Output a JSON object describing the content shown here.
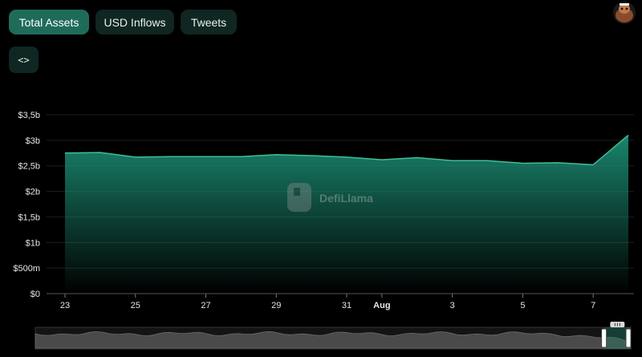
{
  "tabs": [
    {
      "label": "Total Assets",
      "active": true
    },
    {
      "label": "USD Inflows",
      "active": false
    },
    {
      "label": "Tweets",
      "active": false
    }
  ],
  "embed_button": {
    "label": "<>"
  },
  "watermark": {
    "text": "DefiLlama"
  },
  "colors": {
    "accent": "#1f6b5a",
    "tab_bg": "#0f2622",
    "area_line": "#3fbf9a",
    "area_fill_top": "#1b8c72",
    "background": "#000000"
  },
  "chart_data": {
    "type": "area",
    "title": "",
    "xlabel": "",
    "ylabel": "",
    "x": [
      "Jul 23",
      "Jul 24",
      "Jul 25",
      "Jul 26",
      "Jul 27",
      "Jul 28",
      "Jul 29",
      "Jul 30",
      "Jul 31",
      "Aug 1",
      "Aug 2",
      "Aug 3",
      "Aug 4",
      "Aug 5",
      "Aug 6",
      "Aug 7",
      "Aug 8"
    ],
    "values": [
      2.75,
      2.76,
      2.67,
      2.68,
      2.68,
      2.68,
      2.72,
      2.7,
      2.67,
      2.62,
      2.66,
      2.6,
      2.6,
      2.55,
      2.56,
      2.52,
      3.1
    ],
    "value_unit": "$b",
    "ylim": [
      0,
      3.5
    ],
    "y_ticks": [
      {
        "value": 0,
        "label": "$0"
      },
      {
        "value": 0.5,
        "label": "$500m"
      },
      {
        "value": 1,
        "label": "$1b"
      },
      {
        "value": 1.5,
        "label": "$1,5b"
      },
      {
        "value": 2,
        "label": "$2b"
      },
      {
        "value": 2.5,
        "label": "$2,5b"
      },
      {
        "value": 3,
        "label": "$3b"
      },
      {
        "value": 3.5,
        "label": "$3,5b"
      }
    ],
    "x_ticks": [
      {
        "index": 0,
        "label": "23",
        "bold": false
      },
      {
        "index": 2,
        "label": "25",
        "bold": false
      },
      {
        "index": 4,
        "label": "27",
        "bold": false
      },
      {
        "index": 6,
        "label": "29",
        "bold": false
      },
      {
        "index": 8,
        "label": "31",
        "bold": false
      },
      {
        "index": 9,
        "label": "Aug",
        "bold": true
      },
      {
        "index": 11,
        "label": "3",
        "bold": false
      },
      {
        "index": 13,
        "label": "5",
        "bold": false
      },
      {
        "index": 15,
        "label": "7",
        "bold": false
      }
    ],
    "grid": true,
    "legend": "none",
    "brush": {
      "range_start_fraction": 0.955,
      "range_end_fraction": 1.0
    }
  }
}
